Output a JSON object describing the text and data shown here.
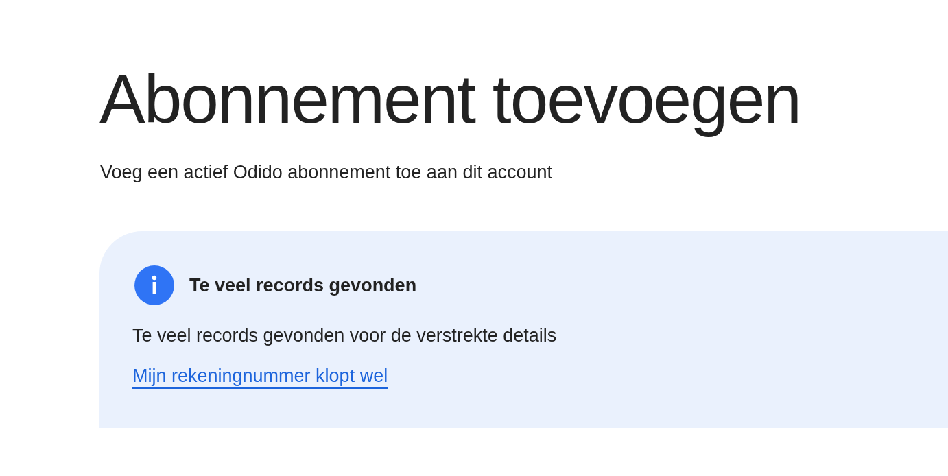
{
  "page": {
    "title": "Abonnement toevoegen",
    "subtitle": "Voeg een actief Odido abonnement toe aan dit account"
  },
  "notice": {
    "kind": "info",
    "title": "Te veel records gevonden",
    "message": "Te veel records gevonden voor de verstrekte details",
    "link": "Mijn rekeningnummer klopt wel"
  }
}
